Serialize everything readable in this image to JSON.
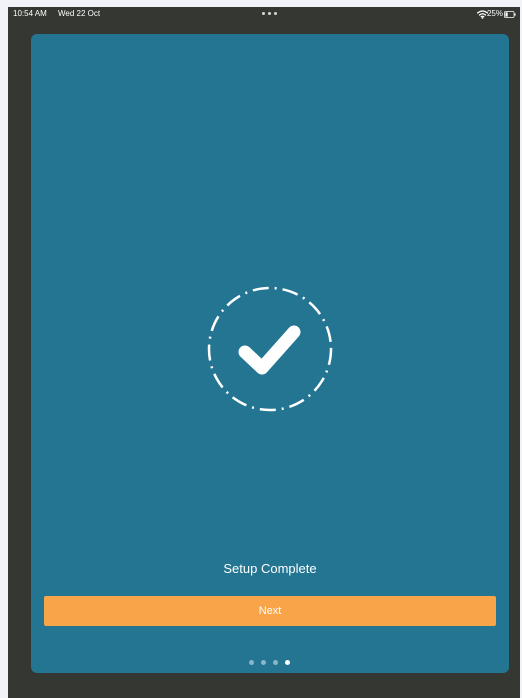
{
  "status_bar": {
    "time": "10:54 AM",
    "date": "Wed 22 Oct",
    "battery": "25%",
    "icons": [
      "more-dots-icon",
      "wifi-icon",
      "battery-icon"
    ]
  },
  "setup": {
    "title": "Setup Complete",
    "icon": "checkmark-icon",
    "next_label": "Next"
  },
  "pagination": {
    "total_pages": 4,
    "current_page": 4
  },
  "colors": {
    "device_bezel": "#353832",
    "card_background": "#247592",
    "button_background": "#f9a448",
    "text": "#ffffff"
  }
}
